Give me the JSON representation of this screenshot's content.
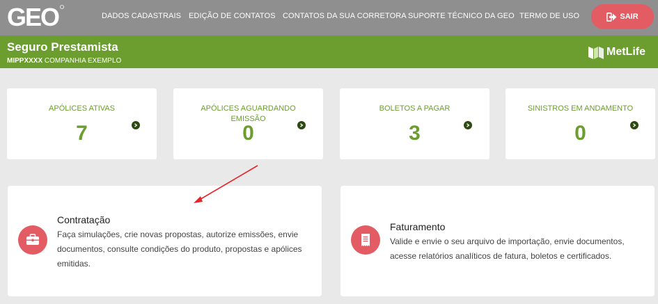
{
  "nav": {
    "logo": "GEO",
    "items": [
      "DADOS CADASTRAIS",
      "EDIÇÃO DE CONTATOS",
      "CONTATOS DA SUA CORRETORA",
      "SUPORTE TÉCNICO DA GEO",
      "TERMO DE USO"
    ],
    "logout_label": "SAIR"
  },
  "product": {
    "title": "Seguro Prestamista",
    "code": "MIPPXXXX",
    "company": "COMPANHIA EXEMPLO",
    "brand": "MetLife"
  },
  "stats": [
    {
      "label": "APÓLICES ATIVAS",
      "value": "7"
    },
    {
      "label": "APÓLICES AGUARDANDO EMISSÃO",
      "value": "0"
    },
    {
      "label": "BOLETOS A PAGAR",
      "value": "3"
    },
    {
      "label": "SINISTROS EM ANDAMENTO",
      "value": "0"
    }
  ],
  "features": [
    {
      "title": "Contratação",
      "description": "Faça simulações, crie novas propostas, autorize emissões, envie documentos, consulte condições do produto, propostas e apólices emitidas.",
      "icon": "briefcase-icon"
    },
    {
      "title": "Faturamento",
      "description": "Valide e envie o seu arquivo de importação, envie documentos, acesse relatórios analíticos de fatura, boletos e certificados.",
      "icon": "receipt-icon"
    }
  ],
  "colors": {
    "nav_bg": "#8f8f8f",
    "brand_green": "#6b9d2f",
    "accent_red": "#e35b63",
    "page_bg": "#e9e9e9"
  }
}
